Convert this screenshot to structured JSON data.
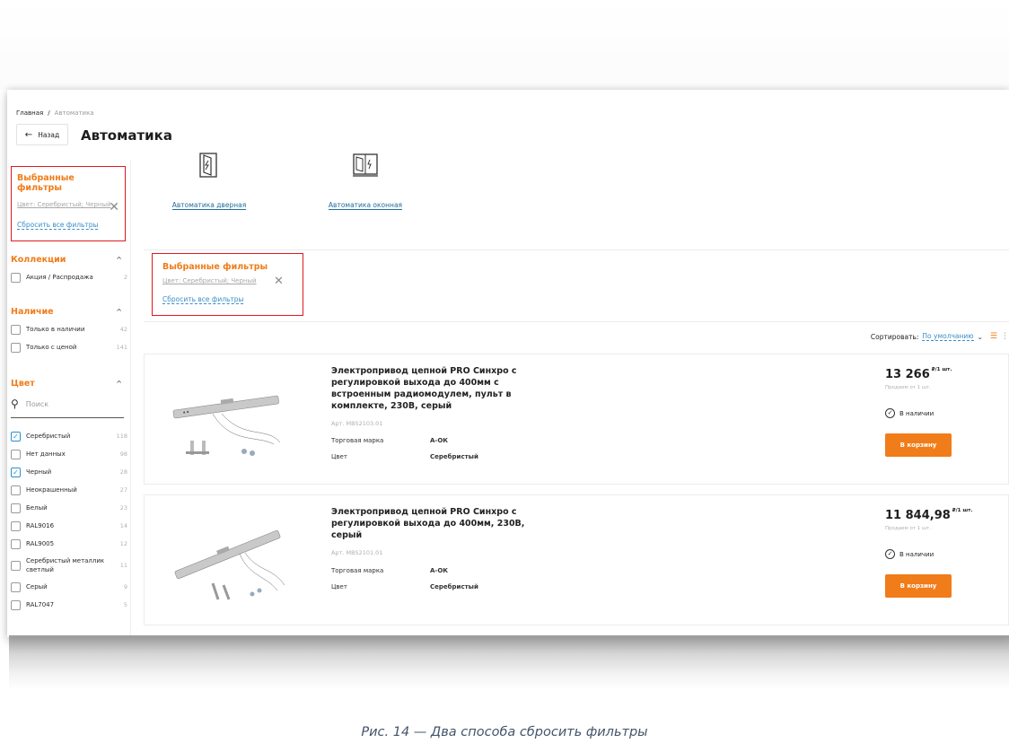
{
  "breadcrumb": {
    "home": "Главная",
    "separator": "/",
    "current": "Автоматика"
  },
  "header": {
    "back_label": "Назад",
    "title": "Автоматика"
  },
  "sidebar": {
    "selected_filters": {
      "title": "Выбранные фильтры",
      "chip": "Цвет: Серебристый; Черный",
      "reset": "Сбросить все фильтры"
    },
    "collections": {
      "title": "Коллекции",
      "options": [
        {
          "label": "Акция / Распродажа",
          "count": "2",
          "checked": false
        }
      ]
    },
    "availability": {
      "title": "Наличие",
      "options": [
        {
          "label": "Только в наличии",
          "count": "42",
          "checked": false
        },
        {
          "label": "Только с ценой",
          "count": "141",
          "checked": false
        }
      ]
    },
    "color": {
      "title": "Цвет",
      "search_placeholder": "Поиск",
      "options": [
        {
          "label": "Серебристый",
          "count": "118",
          "checked": true
        },
        {
          "label": "Нет данных",
          "count": "98",
          "checked": false
        },
        {
          "label": "Черный",
          "count": "28",
          "checked": true
        },
        {
          "label": "Неокрашенный",
          "count": "27",
          "checked": false
        },
        {
          "label": "Белый",
          "count": "23",
          "checked": false
        },
        {
          "label": "RAL9016",
          "count": "14",
          "checked": false
        },
        {
          "label": "RAL9005",
          "count": "12",
          "checked": false
        },
        {
          "label": "Серебристый металлик светлый",
          "count": "11",
          "checked": false
        },
        {
          "label": "Серый",
          "count": "9",
          "checked": false
        },
        {
          "label": "RAL7047",
          "count": "5",
          "checked": false
        }
      ]
    }
  },
  "categories": [
    {
      "label": "Автоматика дверная",
      "icon": "door-automation-icon"
    },
    {
      "label": "Автоматика оконная",
      "icon": "window-automation-icon"
    }
  ],
  "top_filters": {
    "title": "Выбранные фильтры",
    "chip": "Цвет: Серебристый; Черный",
    "reset": "Сбросить все фильтры"
  },
  "sort": {
    "label": "Сортировать:",
    "value": "По умолчанию"
  },
  "products": [
    {
      "name": "Электропривод цепной PRO Синхро с регулировкой выхода до 400мм с встроенным радиомодулем, пульт в комплекте, 230В, серый",
      "article": "Арт. MBS2103.01",
      "brand_label": "Торговая марка",
      "brand": "А-ОК",
      "color_label": "Цвет",
      "color": "Серебристый",
      "price": "13 266",
      "unit": "₽/1 шт.",
      "sold_from": "Продаем от 1 шт.",
      "stock": "В наличии",
      "cart": "В корзину"
    },
    {
      "name": "Электропривод цепной PRO Синхро с регулировкой выхода до 400мм, 230В, серый",
      "article": "Арт. MBS2101.01",
      "brand_label": "Торговая марка",
      "brand": "А-ОК",
      "color_label": "Цвет",
      "color": "Серебристый",
      "price": "11 844,98",
      "unit": "₽/1 шт.",
      "sold_from": "Продаем от 1 шт.",
      "stock": "В наличии",
      "cart": "В корзину"
    }
  ],
  "caption": "Рис. 14 — Два способа сбросить фильтры",
  "colors": {
    "accent": "#f07c1a",
    "highlight_box": "#e1191e",
    "link": "#3a8fc7"
  }
}
